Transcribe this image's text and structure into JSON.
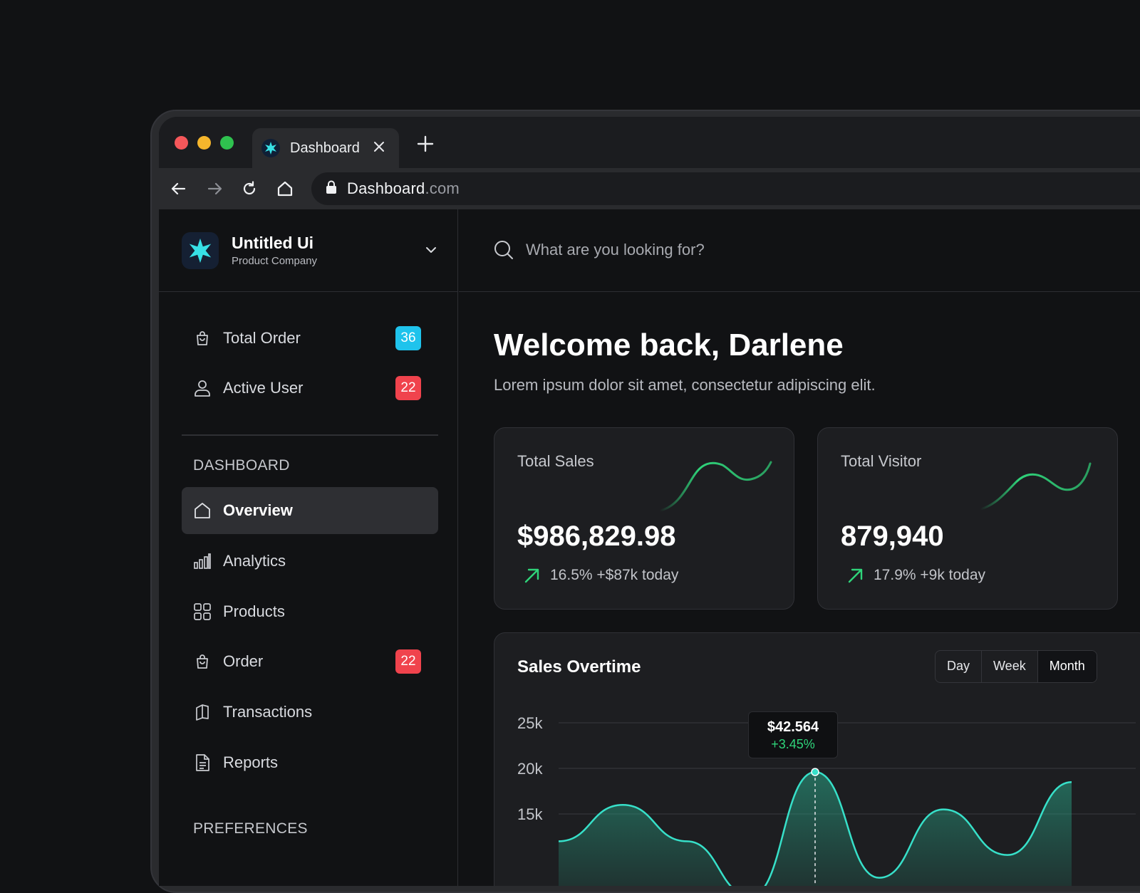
{
  "browser": {
    "tab_title": "Dashboard",
    "url_host": "Dashboard",
    "url_tld": ".com",
    "traffic_colors": [
      "#f5575a",
      "#f6b62c",
      "#2fc24f"
    ]
  },
  "brand": {
    "name": "Untitled Ui",
    "subtitle": "Product Company"
  },
  "search": {
    "placeholder": "What are you looking for?"
  },
  "sidebar": {
    "quick": [
      {
        "label": "Total Order",
        "icon": "shopping-bag-icon",
        "badge": "36",
        "badge_color": "#1fc3ec"
      },
      {
        "label": "Active User",
        "icon": "user-icon",
        "badge": "22",
        "badge_color": "#f0434d"
      }
    ],
    "dashboard_title": "DASHBOARD",
    "items": [
      {
        "label": "Overview",
        "icon": "home-icon",
        "active": true
      },
      {
        "label": "Analytics",
        "icon": "bar-chart-icon"
      },
      {
        "label": "Products",
        "icon": "grid-icon"
      },
      {
        "label": "Order",
        "icon": "shopping-bag-icon",
        "badge": "22"
      },
      {
        "label": "Transactions",
        "icon": "map-icon"
      },
      {
        "label": "Reports",
        "icon": "document-icon"
      }
    ],
    "preferences_title": "PREFERENCES"
  },
  "main": {
    "welcome": "Welcome back, Darlene",
    "subtitle": "Lorem ipsum dolor sit amet, consectetur adipiscing elit.",
    "stats": [
      {
        "label": "Total Sales",
        "value": "$986,829.98",
        "delta": "16.5% +$87k today"
      },
      {
        "label": "Total Visitor",
        "value": "879,940",
        "delta": "17.9% +9k today"
      }
    ],
    "accent_color": "#2fd47a"
  },
  "chart_data": {
    "type": "area",
    "title": "Sales Overtime",
    "ranges": [
      "Day",
      "Week",
      "Month"
    ],
    "selected_range": "Month",
    "y_ticks": [
      "25k",
      "20k",
      "15k"
    ],
    "ylim": [
      0,
      25000
    ],
    "series": [
      {
        "values": [
          12000,
          16000,
          12000,
          6000,
          19600,
          8000,
          15500,
          10500,
          18500
        ]
      }
    ],
    "tooltip": {
      "index": 4,
      "value": "$42.564",
      "delta": "+3.45%"
    },
    "grid": true,
    "color": "#37e0c9"
  }
}
